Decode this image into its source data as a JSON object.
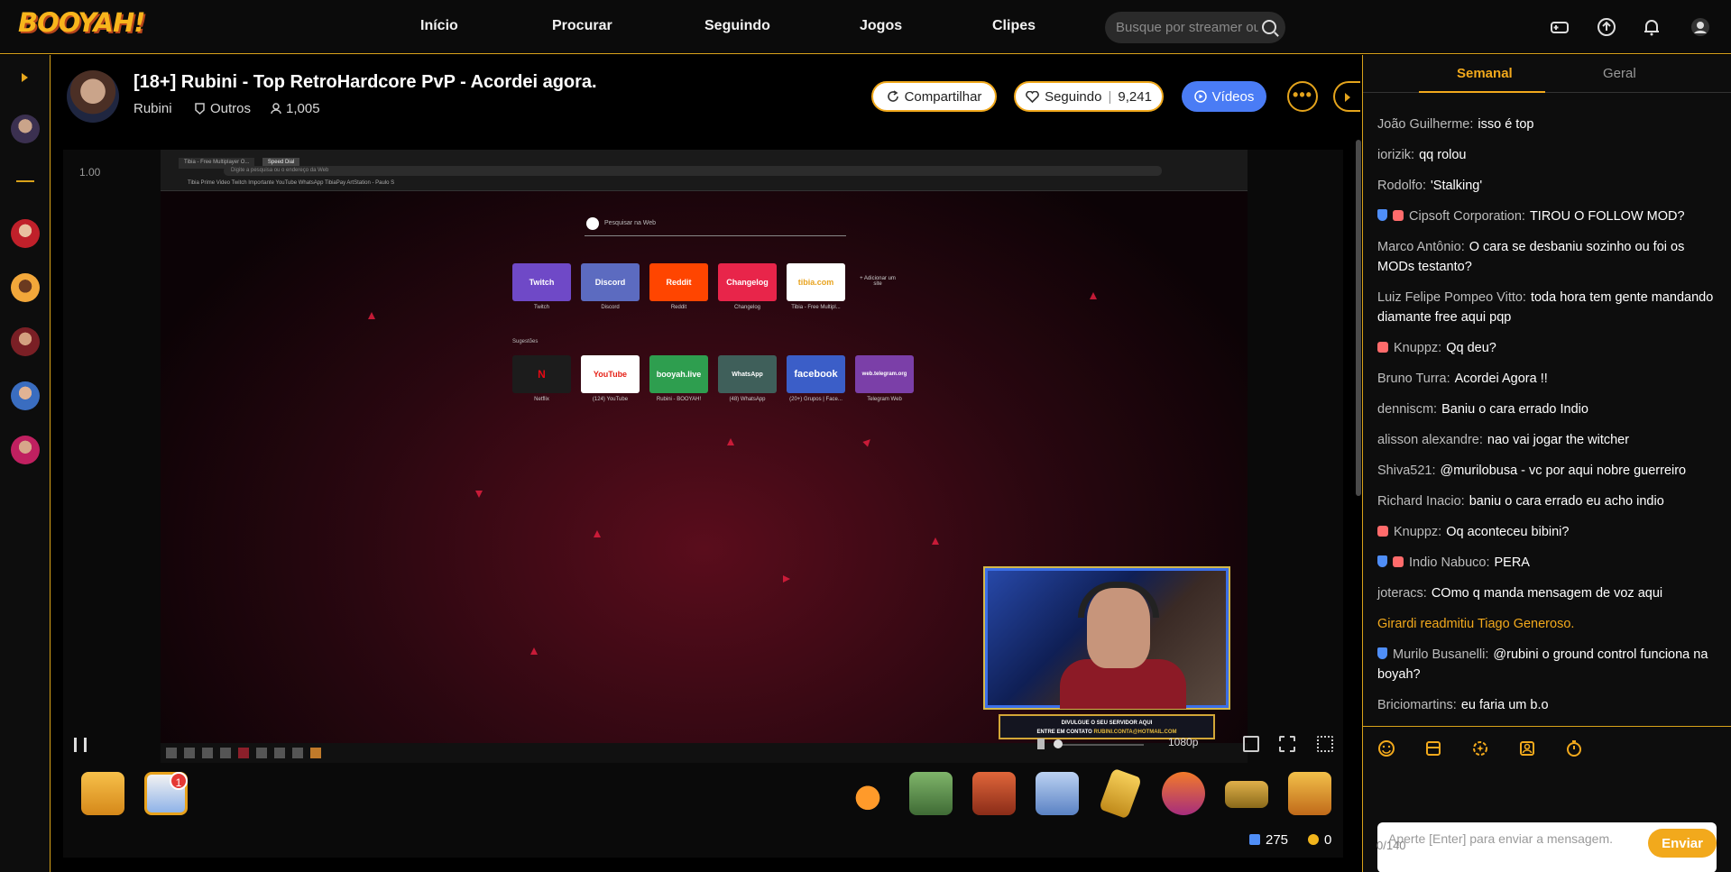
{
  "brand": {
    "logo": "BOOYAH!"
  },
  "nav": [
    "Início",
    "Procurar",
    "Seguindo",
    "Jogos",
    "Clipes"
  ],
  "search": {
    "placeholder": "Busque por streamer ou"
  },
  "stream": {
    "title": "[18+] Rubini - Top RetroHardcore PvP - Acordei agora.",
    "streamer": "Rubini",
    "category": "Outros",
    "viewers": "1,005",
    "share_label": "Compartilhar",
    "follow_label": "Seguindo",
    "followers": "9,241",
    "videos_label": "Vídeos",
    "rate": "1.00",
    "quality": "1080p"
  },
  "screen": {
    "tabs": [
      "Tibia - Free Multiplayer O...",
      "Speed Dial"
    ],
    "address": "Digite a pesquisa ou o endereço da Web",
    "bookmarks": "Tibia   Prime Video   Twitch   Importante   YouTube   WhatsApp   TibiaPay   ArtStation - Paulo S",
    "web_search": "Pesquisar na Web",
    "tiles_row1": [
      {
        "name": "Twitch",
        "label": "Twitch",
        "color": "#6f49c7"
      },
      {
        "name": "Discord",
        "label": "Discord",
        "color": "#5c6bc0"
      },
      {
        "name": "Reddit",
        "label": "Reddit",
        "color": "#ff4500"
      },
      {
        "name": "Changelog",
        "label": "Changelog",
        "color": "#e8254a"
      },
      {
        "name": "tibia.com",
        "label": "Tibia - Free Multipl...",
        "color": "#ffffff"
      }
    ],
    "add_site": "+ Adicionar um site",
    "suggestions": "Sugestões",
    "tiles_row2": [
      {
        "name": "Netflix",
        "label": "Netflix",
        "color": "#1c1c1c"
      },
      {
        "name": "YouTube",
        "label": "(124) YouTube",
        "color": "#ffffff"
      },
      {
        "name": "booyah.live",
        "label": "Rubini - BOOYAH!",
        "color": "#2e9e4f"
      },
      {
        "name": "WhatsApp",
        "label": "(48) WhatsApp",
        "color": "#3f5f5a"
      },
      {
        "name": "facebook",
        "label": "(20+) Grupos | Face...",
        "color": "#3b5ec8"
      },
      {
        "name": "web.telegram.org",
        "label": "Telegram Web",
        "color": "#7b3fa8"
      }
    ],
    "banner_line1": "DIVULGUE O SEU SERVIDOR AQUI",
    "banner_line2": "ENTRE EM CONTATO",
    "banner_email": "RUBINI.CONTA@HOTMAIL.COM"
  },
  "balance": {
    "diamonds": "275",
    "coins": "0"
  },
  "notification_count": "1",
  "chat": {
    "tabs": [
      "Semanal",
      "Geral"
    ],
    "messages": [
      {
        "user": "João Guilherme:",
        "text": "isso é top",
        "badges": []
      },
      {
        "user": "iorizik:",
        "text": "qq rolou",
        "badges": []
      },
      {
        "user": "Rodolfo:",
        "text": "'Stalking'",
        "badges": []
      },
      {
        "user": "Cipsoft Corporation:",
        "text": "TIROU O FOLLOW MOD?",
        "badges": [
          "rank",
          "gift"
        ]
      },
      {
        "user": "Marco Antônio:",
        "text": "O cara se desbaniu sozinho ou foi os MODs testanto?",
        "badges": []
      },
      {
        "user": "Luiz Felipe Pompeo Vitto:",
        "text": "toda hora tem gente mandando diamante free aqui pqp",
        "badges": []
      },
      {
        "user": "Knuppz:",
        "text": "Qq deu?",
        "badges": [
          "gift"
        ]
      },
      {
        "user": "Bruno Turra:",
        "text": "Acordei Agora !!",
        "badges": []
      },
      {
        "user": "denniscm:",
        "text": "Baniu o cara errado Indio",
        "badges": []
      },
      {
        "user": "alisson alexandre:",
        "text": "nao vai jogar the witcher",
        "badges": []
      },
      {
        "user": "Shiva521:",
        "text": "@murilobusa - vc por aqui nobre guerreiro",
        "badges": []
      },
      {
        "user": "Richard Inacio:",
        "text": "baniu o cara errado eu acho indio",
        "badges": []
      },
      {
        "user": "Knuppz:",
        "text": "Oq aconteceu bibini?",
        "badges": [
          "gift"
        ]
      },
      {
        "user": "Indio Nabuco:",
        "text": "PERA",
        "badges": [
          "rank",
          "gift"
        ]
      },
      {
        "user": "joteracs:",
        "text": "COmo q manda mensagem de voz aqui",
        "badges": []
      },
      {
        "system": "Girardi readmitiu Tiago Generoso."
      },
      {
        "user": "Murilo Busanelli:",
        "text": "@rubini o ground control funciona na boyah?",
        "badges": [
          "rank"
        ]
      },
      {
        "user": "Briciomartins:",
        "text": "eu faria um b.o",
        "badges": []
      }
    ],
    "input_placeholder": "Aperte [Enter] para enviar a mensagem.",
    "counter": "0/140",
    "send_label": "Enviar"
  },
  "colors": {
    "accent": "#f2a91c",
    "blue": "#4a7cf5"
  }
}
